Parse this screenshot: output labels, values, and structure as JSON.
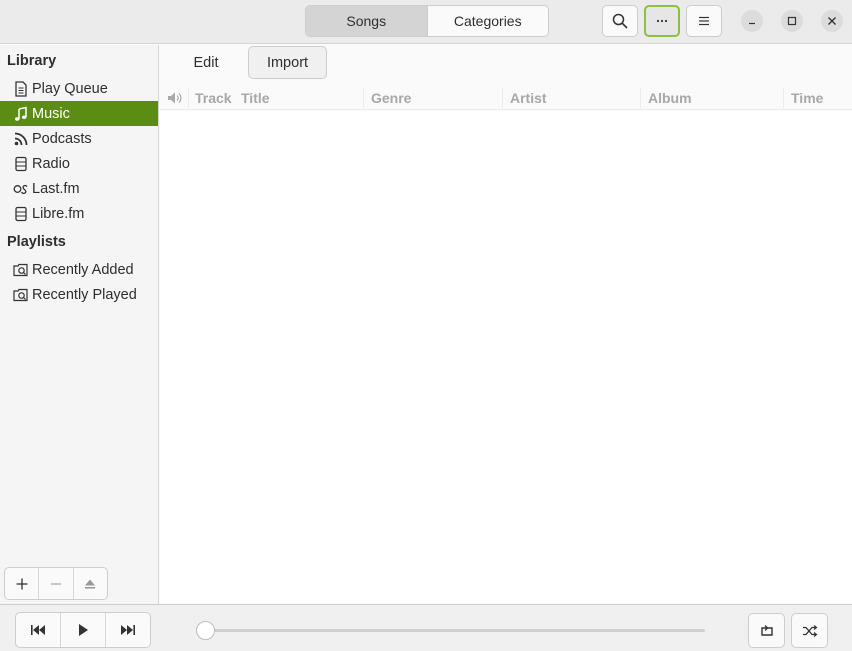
{
  "header": {
    "view_switcher": [
      "Songs",
      "Categories"
    ],
    "active_view": "Songs",
    "buttons": [
      "search-icon",
      "more-icon",
      "menu-icon"
    ],
    "window_controls": [
      "minimize-icon",
      "maximize-icon",
      "close-icon"
    ]
  },
  "sidebar": {
    "library_heading": "Library",
    "library_items": [
      {
        "label": "Play Queue",
        "icon": "document-icon"
      },
      {
        "label": "Music",
        "icon": "music-note-icon",
        "selected": true
      },
      {
        "label": "Podcasts",
        "icon": "rss-icon"
      },
      {
        "label": "Radio",
        "icon": "radio-icon"
      },
      {
        "label": "Last.fm",
        "icon": "lastfm-icon"
      },
      {
        "label": "Libre.fm",
        "icon": "radio-icon"
      }
    ],
    "playlists_heading": "Playlists",
    "playlist_items": [
      {
        "label": "Recently Added",
        "icon": "smart-playlist-icon"
      },
      {
        "label": "Recently Played",
        "icon": "smart-playlist-icon"
      }
    ],
    "bottom_buttons": [
      "add-icon",
      "remove-icon",
      "eject-icon"
    ]
  },
  "toolbar": {
    "edit_label": "Edit",
    "import_label": "Import"
  },
  "columns": [
    "Track",
    "Title",
    "Genre",
    "Artist",
    "Album",
    "Time"
  ],
  "player": {
    "progress": 0,
    "buttons": [
      "previous-icon",
      "play-icon",
      "next-icon",
      "repeat-icon",
      "shuffle-icon"
    ]
  },
  "colors": {
    "accent": "#5b8c14",
    "focus_ring": "#8ac13e"
  }
}
